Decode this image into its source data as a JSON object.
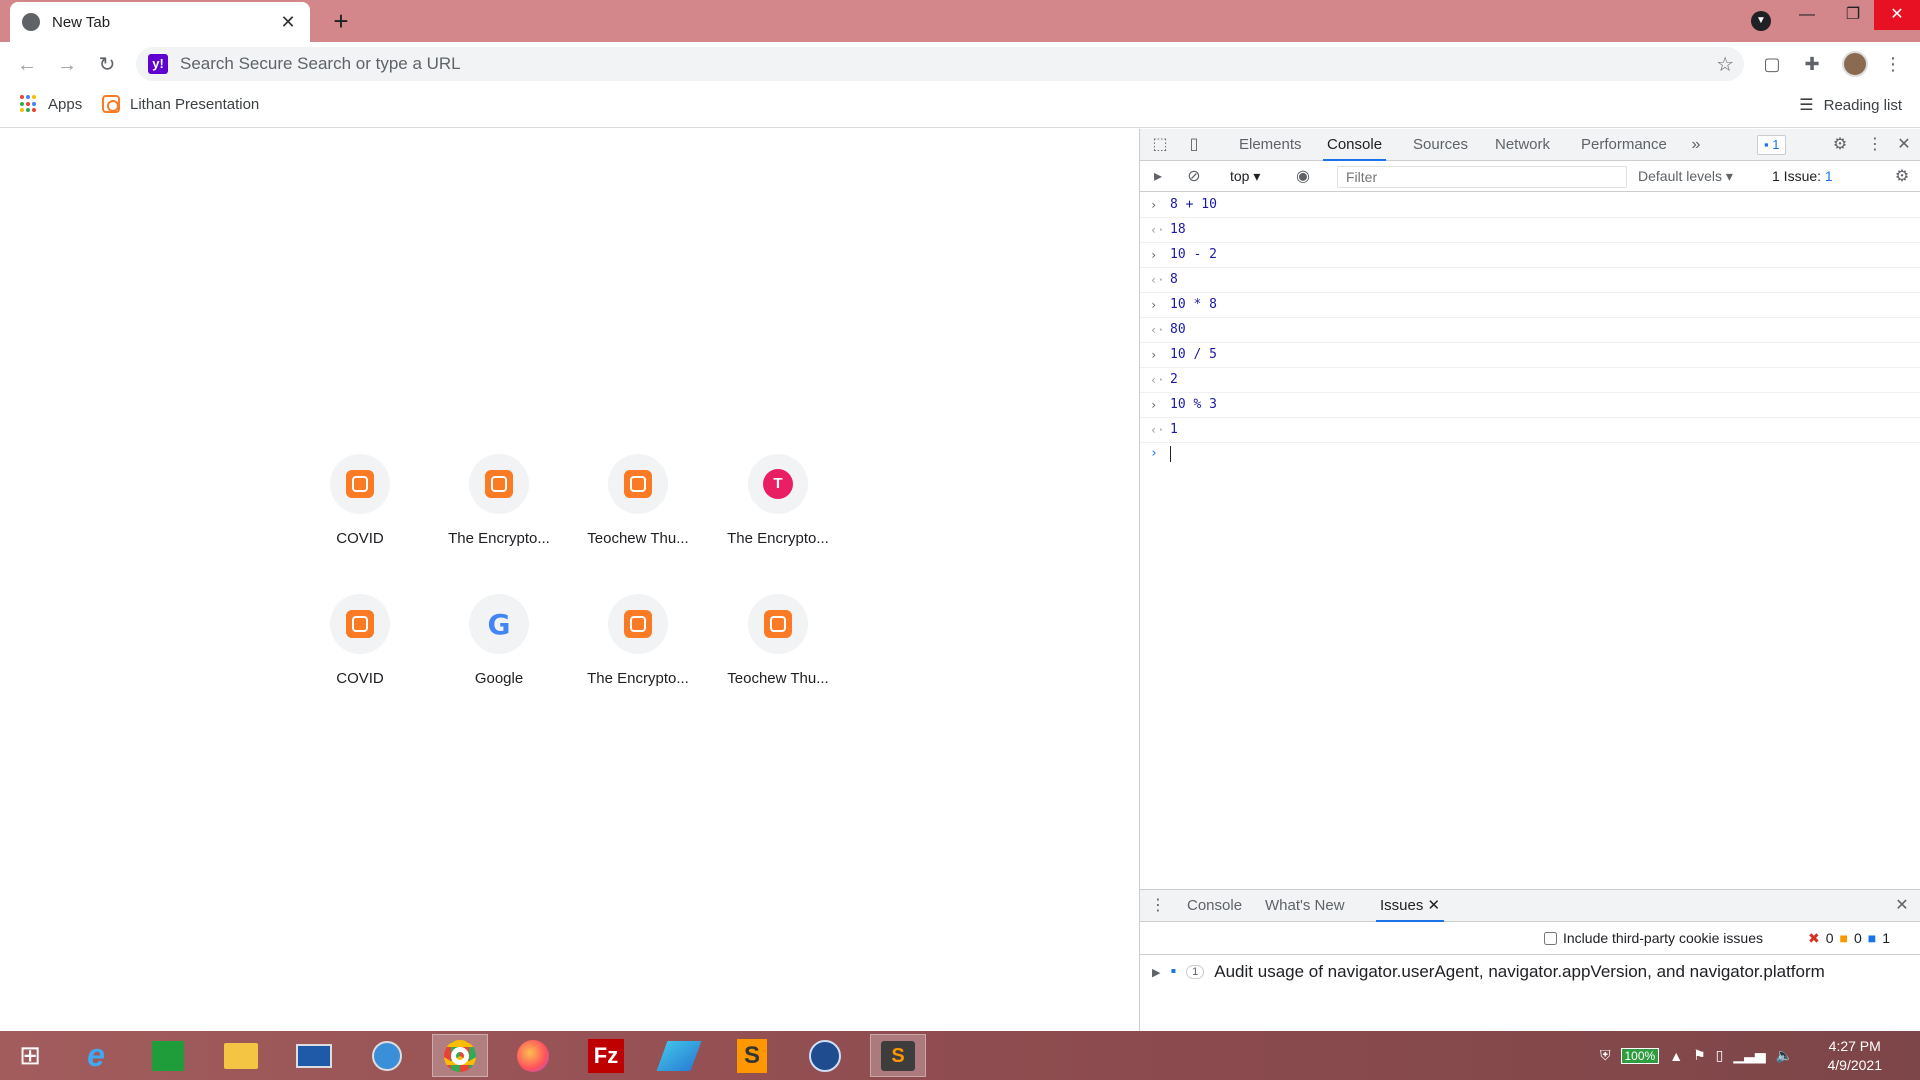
{
  "browser": {
    "tab_title": "New Tab",
    "omnibox_placeholder": "Search Secure Search or type a URL",
    "search_provider_letter": "y!",
    "bookmarks": [
      {
        "label": "Apps"
      },
      {
        "label": "Lithan Presentation"
      }
    ],
    "reading_list": "Reading list"
  },
  "newtab": {
    "tiles": [
      {
        "label": "COVID",
        "icon": "xampp-icon"
      },
      {
        "label": "The Encrypto...",
        "icon": "xampp-icon"
      },
      {
        "label": "Teochew Thu...",
        "icon": "xampp-icon"
      },
      {
        "label": "The Encrypto...",
        "icon": "letter-t-icon",
        "letter": "T"
      },
      {
        "label": "COVID",
        "icon": "xampp-icon"
      },
      {
        "label": "Google",
        "icon": "google-icon",
        "letter": "G"
      },
      {
        "label": "The Encrypto...",
        "icon": "xampp-icon"
      },
      {
        "label": "Teochew Thu...",
        "icon": "xampp-icon"
      }
    ]
  },
  "devtools": {
    "tabs": [
      "Elements",
      "Console",
      "Sources",
      "Network",
      "Performance"
    ],
    "active_tab": "Console",
    "issues_badge": "1",
    "context": "top",
    "filter_placeholder": "Filter",
    "levels": "Default levels",
    "issue_counter": "1 Issue:",
    "issue_counter_num": "1",
    "console_lines": [
      {
        "type": "in",
        "text": "8 + 10"
      },
      {
        "type": "out",
        "text": "18"
      },
      {
        "type": "in",
        "text": "10 - 2"
      },
      {
        "type": "out",
        "text": "8"
      },
      {
        "type": "in",
        "text": "10 * 8"
      },
      {
        "type": "out",
        "text": "80"
      },
      {
        "type": "in",
        "text": "10 / 5"
      },
      {
        "type": "out",
        "text": "2"
      },
      {
        "type": "in",
        "text": "10 % 3"
      },
      {
        "type": "out",
        "text": "1"
      }
    ],
    "drawer": {
      "tabs": [
        "Console",
        "What's New",
        "Issues"
      ],
      "active_tab": "Issues",
      "checkbox_label": "Include third-party cookie issues",
      "errors": "0",
      "warnings": "0",
      "infos": "1",
      "issue_count": "1",
      "issue_text": "Audit usage of navigator.userAgent, navigator.appVersion, and navigator.platform"
    }
  },
  "taskbar": {
    "battery": "100%",
    "time": "4:27 PM",
    "date": "4/9/2021"
  },
  "colors": {
    "titlebar": "#d4878a",
    "accent": "#1a73e8",
    "xampp": "#fb7a24"
  }
}
